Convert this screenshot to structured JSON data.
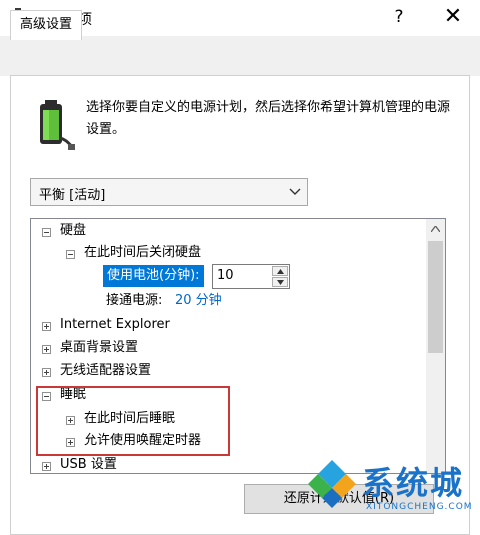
{
  "window": {
    "title": "电源选项",
    "help": "?",
    "close": "✕"
  },
  "tab": {
    "label": "高级设置"
  },
  "description": "选择你要自定义的电源计划，然后选择你希望计算机管理的电源设置。",
  "plan_select": {
    "value": "平衡 [活动]"
  },
  "tree": {
    "hard_disk": "硬盘",
    "turn_off_disk": "在此时间后关闭硬盘",
    "on_battery_label": "使用电池(分钟):",
    "on_battery_value": "10",
    "plugged_in": "接通电源:",
    "plugged_in_value": "20 分钟",
    "internet_explorer": "Internet Explorer",
    "desktop_bg": "桌面背景设置",
    "wireless": "无线适配器设置",
    "sleep": "睡眠",
    "sleep_after": "在此时间后睡眠",
    "wake_timers": "允许使用唤醒定时器",
    "usb": "USB 设置"
  },
  "buttons": {
    "restore": "还原计划默认值(R)"
  },
  "watermark": {
    "text": "系统城",
    "sub": "XITONGCHENG.COM"
  },
  "colors": {
    "selection": "#0078d7",
    "highlight_border": "#c9393a",
    "link": "#0066cc"
  }
}
